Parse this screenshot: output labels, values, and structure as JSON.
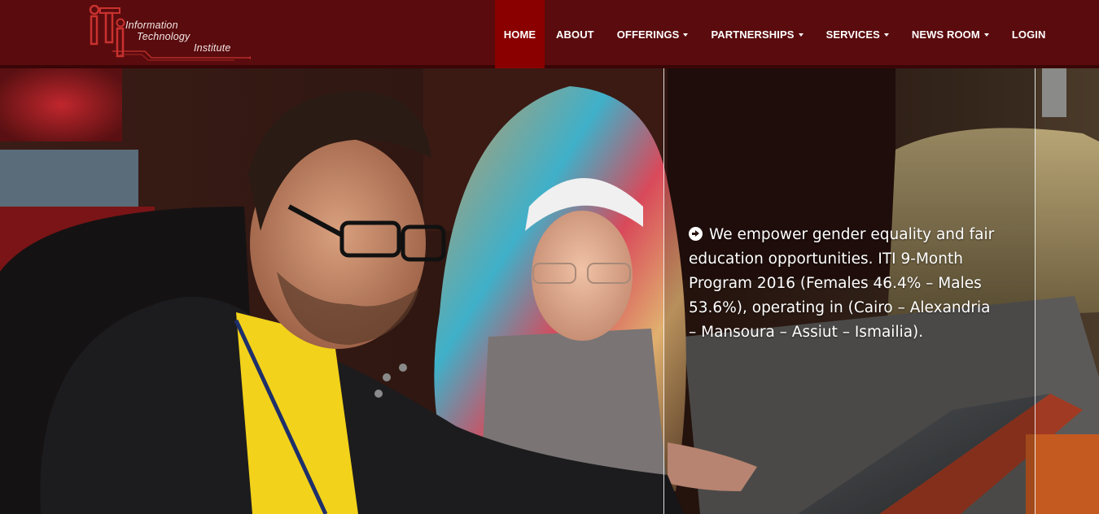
{
  "brand": {
    "logo_lines": [
      "Information",
      "Technology",
      "Institute"
    ],
    "logo_colors": {
      "mark": "#c8322f",
      "text": "#f2e6e6"
    }
  },
  "nav": {
    "items": [
      {
        "label": "HOME",
        "active": true,
        "dropdown": false
      },
      {
        "label": "ABOUT",
        "active": false,
        "dropdown": false
      },
      {
        "label": "OFFERINGS",
        "active": false,
        "dropdown": true
      },
      {
        "label": "PARTNERSHIPS",
        "active": false,
        "dropdown": true
      },
      {
        "label": "SERVICES",
        "active": false,
        "dropdown": true
      },
      {
        "label": "NEWS ROOM",
        "active": false,
        "dropdown": true
      },
      {
        "label": "LOGIN",
        "active": false,
        "dropdown": false
      }
    ]
  },
  "hero": {
    "icon": "circle-arrow-right-icon",
    "text": "We empower gender equality and fair education opportunities. ITI 9-Month Program 2016 (Females 46.4% – Males 53.6%), operating in (Cairo – Alexandria – Mansoura – Assiut – Ismailia)."
  },
  "colors": {
    "header_bg": "#5a0b0d",
    "nav_active_bg": "#8a0000",
    "nav_text": "#ffffff"
  }
}
